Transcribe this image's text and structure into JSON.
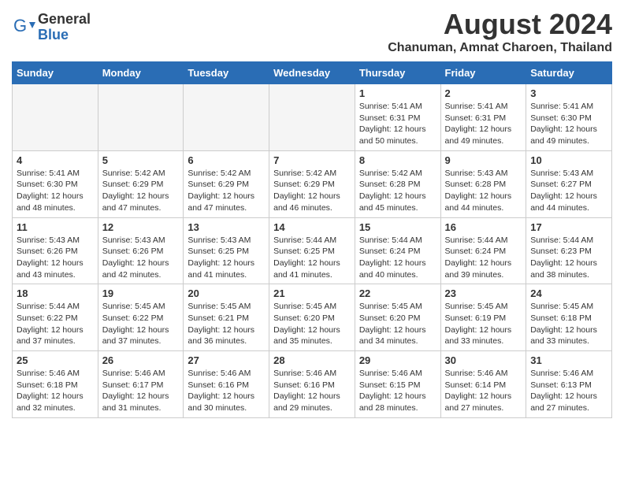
{
  "header": {
    "logo_general": "General",
    "logo_blue": "Blue",
    "month_year": "August 2024",
    "location": "Chanuman, Amnat Charoen, Thailand"
  },
  "weekdays": [
    "Sunday",
    "Monday",
    "Tuesday",
    "Wednesday",
    "Thursday",
    "Friday",
    "Saturday"
  ],
  "weeks": [
    [
      {
        "day": "",
        "info": ""
      },
      {
        "day": "",
        "info": ""
      },
      {
        "day": "",
        "info": ""
      },
      {
        "day": "",
        "info": ""
      },
      {
        "day": "1",
        "info": "Sunrise: 5:41 AM\nSunset: 6:31 PM\nDaylight: 12 hours\nand 50 minutes."
      },
      {
        "day": "2",
        "info": "Sunrise: 5:41 AM\nSunset: 6:31 PM\nDaylight: 12 hours\nand 49 minutes."
      },
      {
        "day": "3",
        "info": "Sunrise: 5:41 AM\nSunset: 6:30 PM\nDaylight: 12 hours\nand 49 minutes."
      }
    ],
    [
      {
        "day": "4",
        "info": "Sunrise: 5:41 AM\nSunset: 6:30 PM\nDaylight: 12 hours\nand 48 minutes."
      },
      {
        "day": "5",
        "info": "Sunrise: 5:42 AM\nSunset: 6:29 PM\nDaylight: 12 hours\nand 47 minutes."
      },
      {
        "day": "6",
        "info": "Sunrise: 5:42 AM\nSunset: 6:29 PM\nDaylight: 12 hours\nand 47 minutes."
      },
      {
        "day": "7",
        "info": "Sunrise: 5:42 AM\nSunset: 6:29 PM\nDaylight: 12 hours\nand 46 minutes."
      },
      {
        "day": "8",
        "info": "Sunrise: 5:42 AM\nSunset: 6:28 PM\nDaylight: 12 hours\nand 45 minutes."
      },
      {
        "day": "9",
        "info": "Sunrise: 5:43 AM\nSunset: 6:28 PM\nDaylight: 12 hours\nand 44 minutes."
      },
      {
        "day": "10",
        "info": "Sunrise: 5:43 AM\nSunset: 6:27 PM\nDaylight: 12 hours\nand 44 minutes."
      }
    ],
    [
      {
        "day": "11",
        "info": "Sunrise: 5:43 AM\nSunset: 6:26 PM\nDaylight: 12 hours\nand 43 minutes."
      },
      {
        "day": "12",
        "info": "Sunrise: 5:43 AM\nSunset: 6:26 PM\nDaylight: 12 hours\nand 42 minutes."
      },
      {
        "day": "13",
        "info": "Sunrise: 5:43 AM\nSunset: 6:25 PM\nDaylight: 12 hours\nand 41 minutes."
      },
      {
        "day": "14",
        "info": "Sunrise: 5:44 AM\nSunset: 6:25 PM\nDaylight: 12 hours\nand 41 minutes."
      },
      {
        "day": "15",
        "info": "Sunrise: 5:44 AM\nSunset: 6:24 PM\nDaylight: 12 hours\nand 40 minutes."
      },
      {
        "day": "16",
        "info": "Sunrise: 5:44 AM\nSunset: 6:24 PM\nDaylight: 12 hours\nand 39 minutes."
      },
      {
        "day": "17",
        "info": "Sunrise: 5:44 AM\nSunset: 6:23 PM\nDaylight: 12 hours\nand 38 minutes."
      }
    ],
    [
      {
        "day": "18",
        "info": "Sunrise: 5:44 AM\nSunset: 6:22 PM\nDaylight: 12 hours\nand 37 minutes."
      },
      {
        "day": "19",
        "info": "Sunrise: 5:45 AM\nSunset: 6:22 PM\nDaylight: 12 hours\nand 37 minutes."
      },
      {
        "day": "20",
        "info": "Sunrise: 5:45 AM\nSunset: 6:21 PM\nDaylight: 12 hours\nand 36 minutes."
      },
      {
        "day": "21",
        "info": "Sunrise: 5:45 AM\nSunset: 6:20 PM\nDaylight: 12 hours\nand 35 minutes."
      },
      {
        "day": "22",
        "info": "Sunrise: 5:45 AM\nSunset: 6:20 PM\nDaylight: 12 hours\nand 34 minutes."
      },
      {
        "day": "23",
        "info": "Sunrise: 5:45 AM\nSunset: 6:19 PM\nDaylight: 12 hours\nand 33 minutes."
      },
      {
        "day": "24",
        "info": "Sunrise: 5:45 AM\nSunset: 6:18 PM\nDaylight: 12 hours\nand 33 minutes."
      }
    ],
    [
      {
        "day": "25",
        "info": "Sunrise: 5:46 AM\nSunset: 6:18 PM\nDaylight: 12 hours\nand 32 minutes."
      },
      {
        "day": "26",
        "info": "Sunrise: 5:46 AM\nSunset: 6:17 PM\nDaylight: 12 hours\nand 31 minutes."
      },
      {
        "day": "27",
        "info": "Sunrise: 5:46 AM\nSunset: 6:16 PM\nDaylight: 12 hours\nand 30 minutes."
      },
      {
        "day": "28",
        "info": "Sunrise: 5:46 AM\nSunset: 6:16 PM\nDaylight: 12 hours\nand 29 minutes."
      },
      {
        "day": "29",
        "info": "Sunrise: 5:46 AM\nSunset: 6:15 PM\nDaylight: 12 hours\nand 28 minutes."
      },
      {
        "day": "30",
        "info": "Sunrise: 5:46 AM\nSunset: 6:14 PM\nDaylight: 12 hours\nand 27 minutes."
      },
      {
        "day": "31",
        "info": "Sunrise: 5:46 AM\nSunset: 6:13 PM\nDaylight: 12 hours\nand 27 minutes."
      }
    ]
  ]
}
